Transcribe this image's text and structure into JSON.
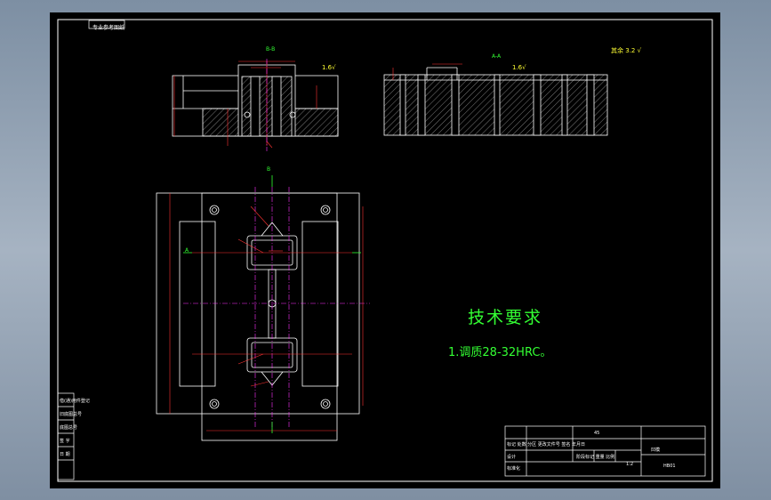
{
  "drawing_code": "专业参考图纸",
  "section_labels": {
    "left_view": "B-B",
    "right_view": "A-A",
    "plan_top": "B",
    "plan_left": "A"
  },
  "roughness": {
    "general_text": "其余",
    "value": "3.2",
    "face_value": "1.6"
  },
  "technical_requirements": {
    "title": "技术要求",
    "items": [
      "1.调质28-32HRC。"
    ]
  },
  "title_block": {
    "part_name": "凹模",
    "material": "45",
    "scale": "1:2",
    "sheet": "1",
    "drawing_no": "HB01",
    "header_left": "标记 处数 分区 更改文件号 签名 年月日",
    "designer": "设计",
    "std": "标准化",
    "stage": "阶段标记 重量 比例"
  },
  "left_margin_labels": [
    "借(通)用件登记",
    "旧底图总号",
    "底图总号",
    "签 字",
    "日 期"
  ],
  "colors": {
    "outline": "#ffffff",
    "section": "#33ff33",
    "dim": "#ff3333",
    "center": "#ff33ff",
    "hatch": "#dddddd",
    "note": "#33ff33",
    "rough": "#ffff33"
  }
}
